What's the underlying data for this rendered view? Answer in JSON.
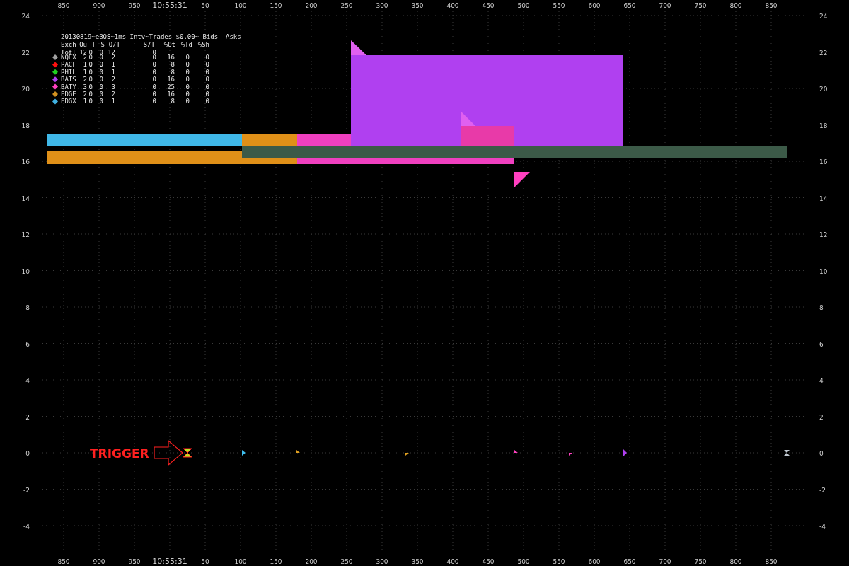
{
  "top_axis": {
    "labels": [
      "850",
      "900",
      "950",
      "10:55:31",
      "50",
      "100",
      "150",
      "200",
      "250",
      "300",
      "350",
      "400",
      "450",
      "500",
      "550",
      "600",
      "650",
      "700",
      "750",
      "800",
      "850"
    ]
  },
  "bottom_axis": {
    "labels": [
      "850",
      "900",
      "950",
      "10:55:31",
      "50",
      "100",
      "150",
      "200",
      "250",
      "300",
      "350",
      "400",
      "450",
      "500",
      "550",
      "600",
      "650",
      "700",
      "750",
      "800",
      "850"
    ]
  },
  "left_axis": {
    "labels": [
      "24",
      "22",
      "20",
      "18",
      "16",
      "14",
      "12",
      "10",
      "8",
      "6",
      "4",
      "2",
      "0",
      "-2",
      "-4"
    ]
  },
  "right_axis": {
    "labels": [
      "24",
      "22",
      "20",
      "18",
      "16",
      "14",
      "12",
      "10",
      "8",
      "6",
      "4",
      "2",
      "0",
      "-2",
      "-4"
    ]
  },
  "legend": {
    "title": "20130819~eBOS~1ms Intv~Trades $0.00~ Bids  Asks",
    "columns": [
      "Exch",
      "Qu",
      "T",
      "S",
      "Q/T",
      "S/T",
      "%Qt",
      "%Td",
      "%Sh"
    ],
    "total": [
      "Totl",
      "12",
      "0",
      "0",
      "12",
      "0"
    ],
    "rows": [
      {
        "exchange": "NQEX",
        "color": "#a0a0a0",
        "values": [
          "2",
          "0",
          "0",
          "2",
          "0",
          "16",
          "0",
          "0"
        ]
      },
      {
        "exchange": "PACF",
        "color": "#ff1010",
        "values": [
          "1",
          "0",
          "0",
          "1",
          "0",
          "8",
          "0",
          "0"
        ]
      },
      {
        "exchange": "PHIL",
        "color": "#20d020",
        "values": [
          "1",
          "0",
          "0",
          "1",
          "0",
          "8",
          "0",
          "0"
        ]
      },
      {
        "exchange": "BATS",
        "color": "#b040f0",
        "values": [
          "2",
          "0",
          "0",
          "2",
          "0",
          "16",
          "0",
          "0"
        ]
      },
      {
        "exchange": "BATY",
        "color": "#ff40c0",
        "values": [
          "3",
          "0",
          "0",
          "3",
          "0",
          "25",
          "0",
          "0"
        ]
      },
      {
        "exchange": "EDGE",
        "color": "#d09020",
        "values": [
          "2",
          "0",
          "0",
          "2",
          "0",
          "16",
          "0",
          "0"
        ]
      },
      {
        "exchange": "EDGX",
        "color": "#40b0e0",
        "values": [
          "1",
          "0",
          "0",
          "1",
          "0",
          "8",
          "0",
          "0"
        ]
      }
    ]
  },
  "trigger": {
    "label": "TRIGGER"
  }
}
